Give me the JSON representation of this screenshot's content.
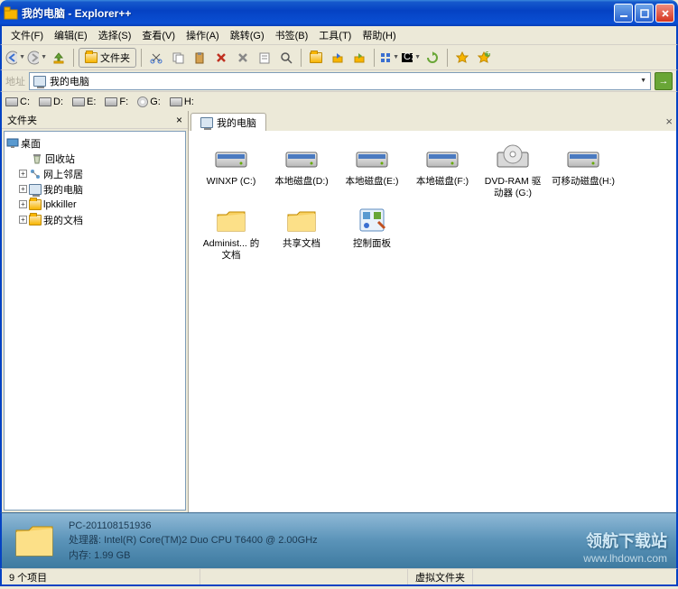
{
  "window": {
    "title": "我的电脑 - Explorer++"
  },
  "menu": [
    "文件(F)",
    "编辑(E)",
    "选择(S)",
    "查看(V)",
    "操作(A)",
    "跳转(G)",
    "书签(B)",
    "工具(T)",
    "帮助(H)"
  ],
  "toolbar": {
    "folders_label": "文件夹"
  },
  "address": {
    "label": "地址",
    "value": "我的电脑"
  },
  "drives": [
    "C:",
    "D:",
    "E:",
    "F:",
    "G:",
    "H:"
  ],
  "sidebar": {
    "title": "文件夹",
    "root": "桌面",
    "items": [
      "回收站",
      "网上邻居",
      "我的电脑",
      "lpkkiller",
      "我的文档"
    ]
  },
  "tab": {
    "label": "我的电脑"
  },
  "files": [
    {
      "name": "WINXP (C:)",
      "type": "drive"
    },
    {
      "name": "本地磁盘(D:)",
      "type": "drive"
    },
    {
      "name": "本地磁盘(E:)",
      "type": "drive"
    },
    {
      "name": "本地磁盘(F:)",
      "type": "drive"
    },
    {
      "name": "DVD-RAM 驱动器 (G:)",
      "type": "cd"
    },
    {
      "name": "可移动磁盘(H:)",
      "type": "drive"
    },
    {
      "name": "Administ... 的文档",
      "type": "folder"
    },
    {
      "name": "共享文档",
      "type": "folder"
    },
    {
      "name": "控制面板",
      "type": "cpanel"
    }
  ],
  "info": {
    "line1": "PC-201108151936",
    "line2": "处理器:   Intel(R) Core(TM)2 Duo CPU     T6400  @ 2.00GHz",
    "line3": "内存:  1.99 GB"
  },
  "watermark": {
    "title": "领航下载站",
    "url": "www.lhdown.com"
  },
  "status": {
    "items": "9 个项目",
    "type": "虚拟文件夹"
  }
}
